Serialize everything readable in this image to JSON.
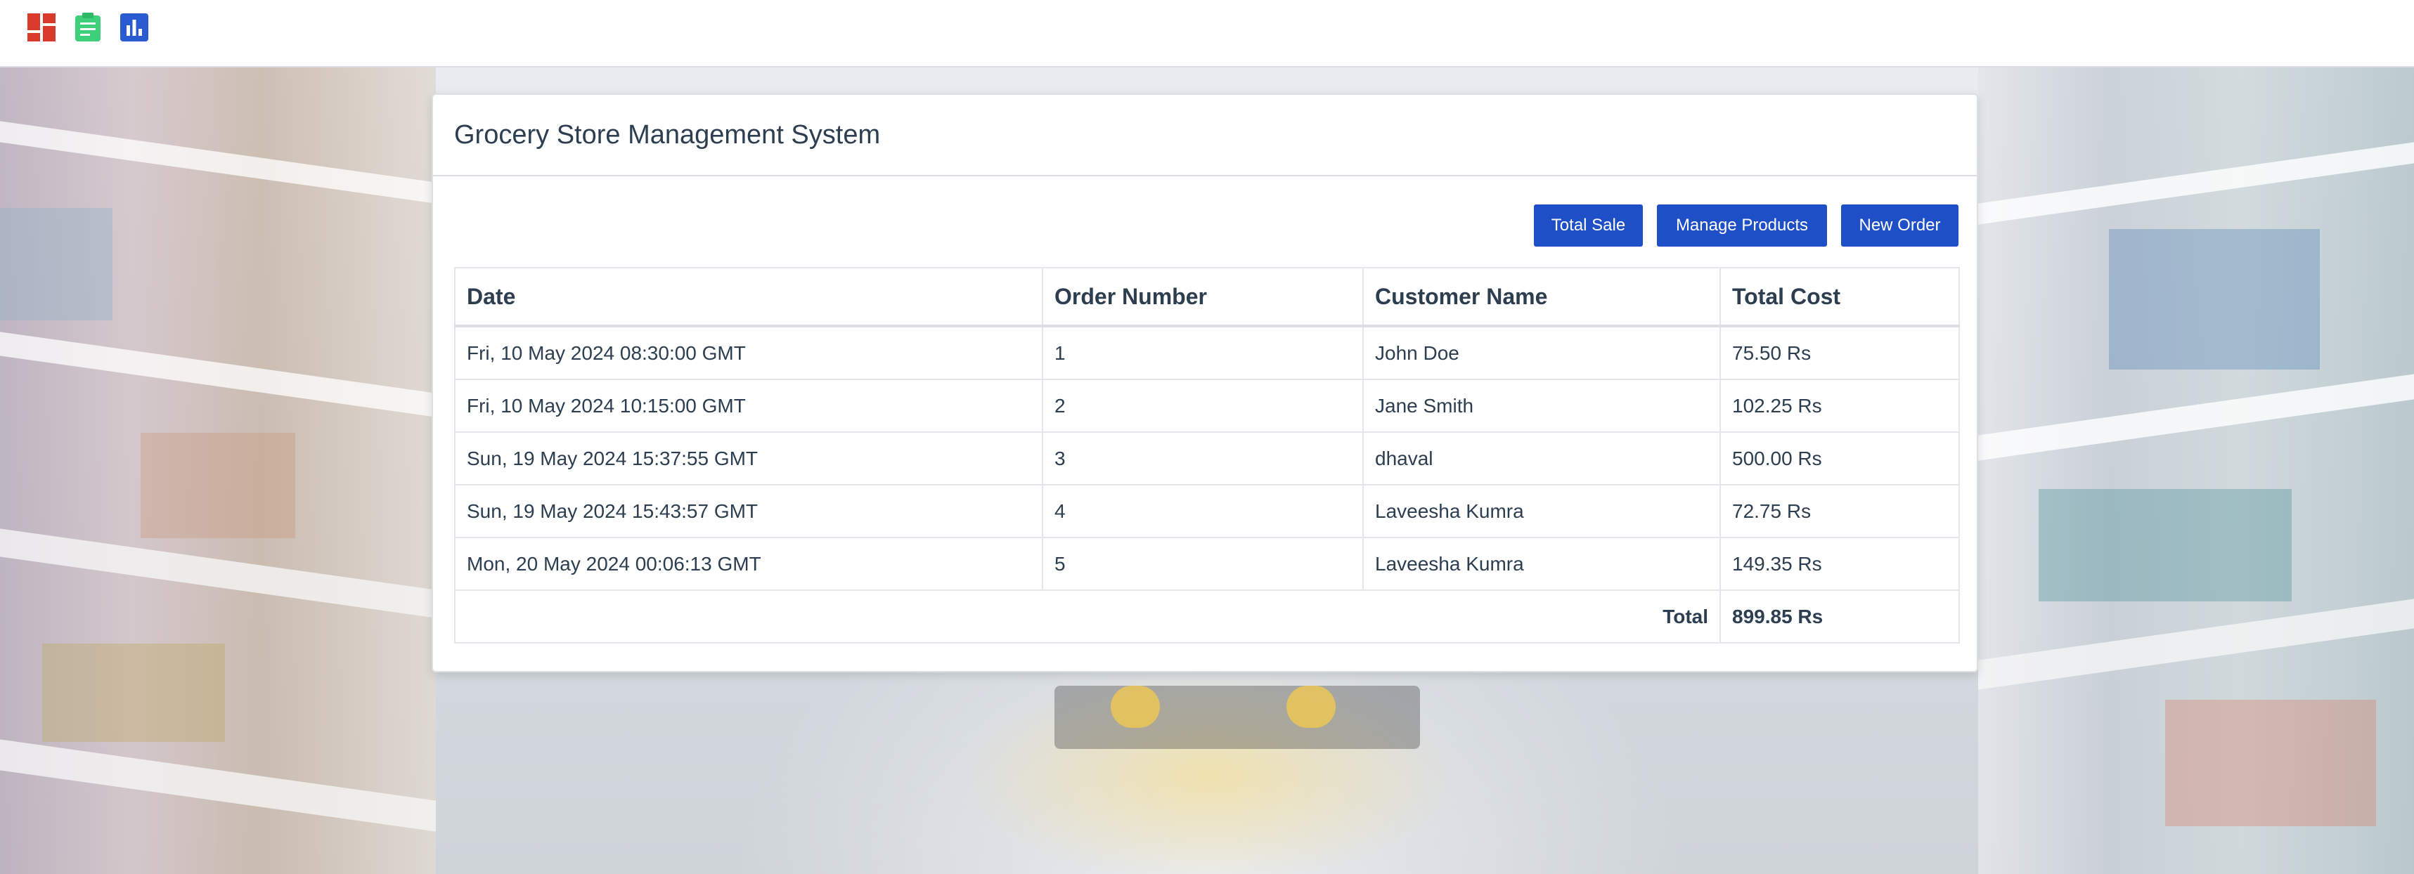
{
  "nav": {
    "icons": [
      {
        "name": "dashboard-icon",
        "color": "#d93a2b"
      },
      {
        "name": "clipboard-icon",
        "color": "#3ecf7a"
      },
      {
        "name": "bar-chart-icon",
        "color": "#2a5bd0"
      }
    ]
  },
  "panel": {
    "title": "Grocery Store Management System"
  },
  "toolbar": {
    "total_sale_label": "Total Sale",
    "manage_products_label": "Manage Products",
    "new_order_label": "New Order"
  },
  "table": {
    "headers": {
      "date": "Date",
      "order_number": "Order Number",
      "customer_name": "Customer Name",
      "total_cost": "Total Cost"
    },
    "rows": [
      {
        "date": "Fri, 10 May 2024 08:30:00 GMT",
        "order_number": "1",
        "customer_name": "John Doe",
        "total_cost": "75.50 Rs"
      },
      {
        "date": "Fri, 10 May 2024 10:15:00 GMT",
        "order_number": "2",
        "customer_name": "Jane Smith",
        "total_cost": "102.25 Rs"
      },
      {
        "date": "Sun, 19 May 2024 15:37:55 GMT",
        "order_number": "3",
        "customer_name": "dhaval",
        "total_cost": "500.00 Rs"
      },
      {
        "date": "Sun, 19 May 2024 15:43:57 GMT",
        "order_number": "4",
        "customer_name": "Laveesha Kumra",
        "total_cost": "72.75 Rs"
      },
      {
        "date": "Mon, 20 May 2024 00:06:13 GMT",
        "order_number": "5",
        "customer_name": "Laveesha Kumra",
        "total_cost": "149.35 Rs"
      }
    ],
    "total_label": "Total",
    "total_value": "899.85 Rs"
  },
  "colors": {
    "button": "#1f4fc7",
    "text": "#2c3e50"
  }
}
